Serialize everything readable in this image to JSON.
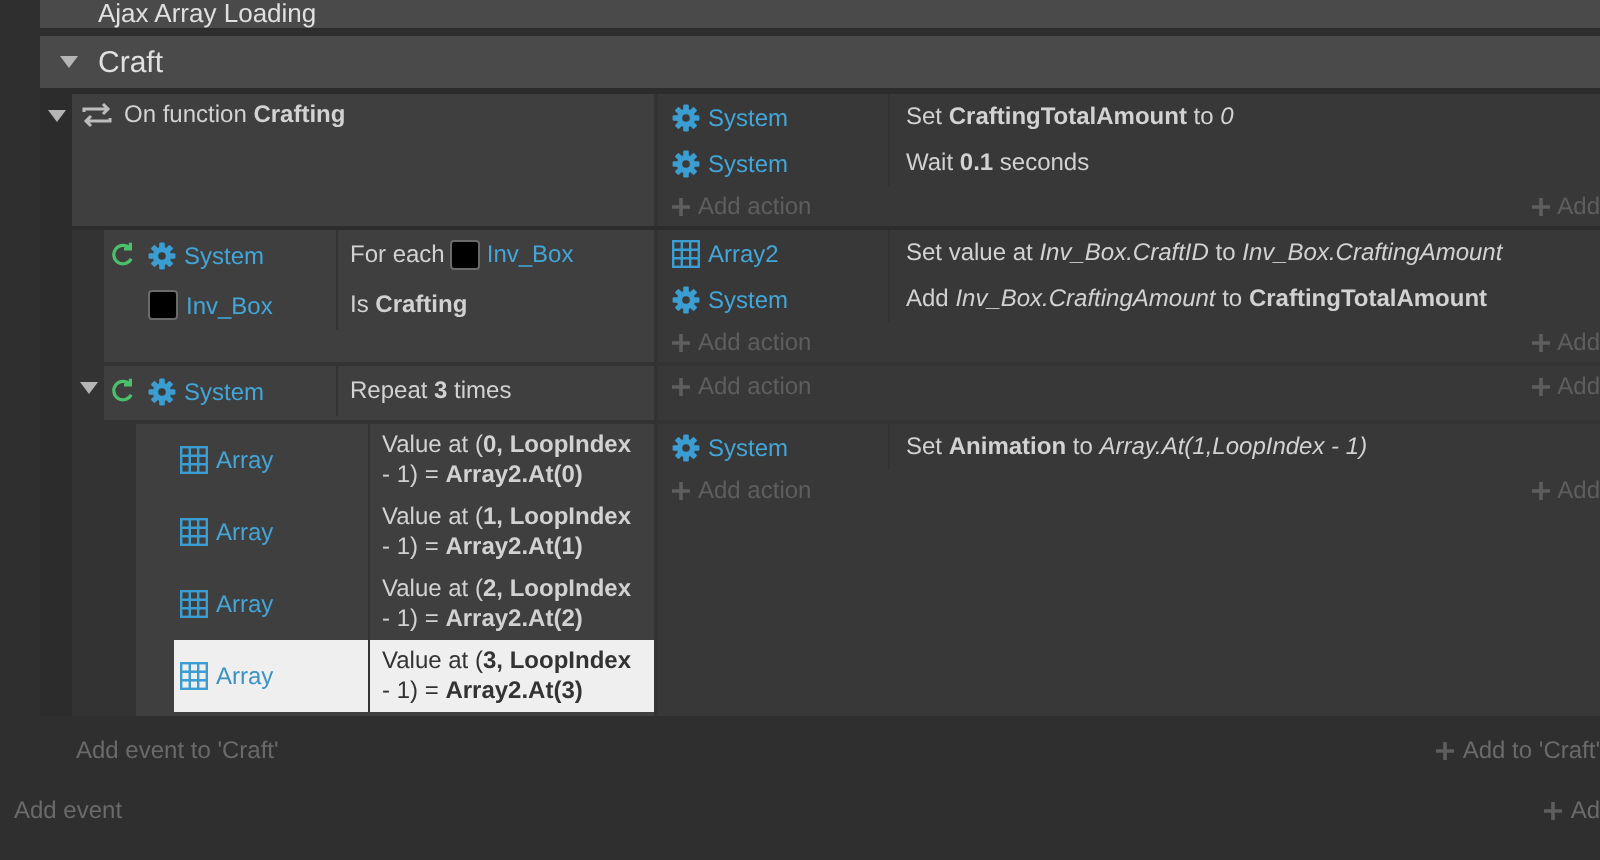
{
  "groups": [
    {
      "title": "Ajax Array Loading"
    },
    {
      "title": "Craft",
      "expanded": true,
      "events": [
        {
          "expanded": true,
          "loop": false,
          "conditions": [
            {
              "kind": "function",
              "text": "On function **Crafting**",
              "selected": false
            }
          ],
          "actions": [
            {
              "kind": "system",
              "object": "System",
              "text": "Set **CraftingTotalAmount** to *0*"
            },
            {
              "kind": "system",
              "object": "System",
              "text": "Wait **0.1** seconds"
            }
          ],
          "add_action": "Add action",
          "add_right": "Add",
          "children": [
            {
              "loop": true,
              "conditions": [
                {
                  "kind": "system",
                  "object": "System",
                  "text": "For each",
                  "param": {
                    "kind": "sprite",
                    "name": "Inv_Box"
                  },
                  "selected": false
                },
                {
                  "kind": "sprite",
                  "object": "Inv_Box",
                  "text": "Is **Crafting**",
                  "selected": false
                }
              ],
              "actions": [
                {
                  "kind": "array",
                  "object": "Array2",
                  "text": "Set value at *Inv_Box.CraftID* to *Inv_Box.CraftingAmount*"
                },
                {
                  "kind": "system",
                  "object": "System",
                  "text": "Add *Inv_Box.CraftingAmount* to **CraftingTotalAmount**"
                }
              ],
              "add_action": "Add action",
              "add_right": "Add"
            },
            {
              "expanded": true,
              "loop": true,
              "conditions": [
                {
                  "kind": "system",
                  "object": "System",
                  "text": "Repeat **3** times",
                  "selected": false
                }
              ],
              "add_action": "Add action",
              "add_right": "Add",
              "children": [
                {
                  "loop": false,
                  "conditions": [
                    {
                      "kind": "array",
                      "object": "Array",
                      "text": "Value at (**0,** **LoopIndex** - 1) = **Array2.At(0)**",
                      "selected": false
                    },
                    {
                      "kind": "array",
                      "object": "Array",
                      "text": "Value at (**1,** **LoopIndex** - 1) = **Array2.At(1)**",
                      "selected": false
                    },
                    {
                      "kind": "array",
                      "object": "Array",
                      "text": "Value at (**2,** **LoopIndex** - 1) = **Array2.At(2)**",
                      "selected": false
                    },
                    {
                      "kind": "array",
                      "object": "Array",
                      "text": "Value at (**3,** **LoopIndex** - 1) = **Array2.At(3)**",
                      "selected": true
                    }
                  ],
                  "actions": [
                    {
                      "kind": "system",
                      "object": "System",
                      "text": "Set **Animation** to *Array.At(1,LoopIndex - 1)*"
                    }
                  ],
                  "add_action": "Add action",
                  "add_right": "Add"
                }
              ]
            }
          ]
        }
      ],
      "add_event": "Add event to 'Craft'",
      "add_right": "Add to 'Craft'"
    }
  ],
  "add_event": "Add event",
  "add_right": "Ad"
}
